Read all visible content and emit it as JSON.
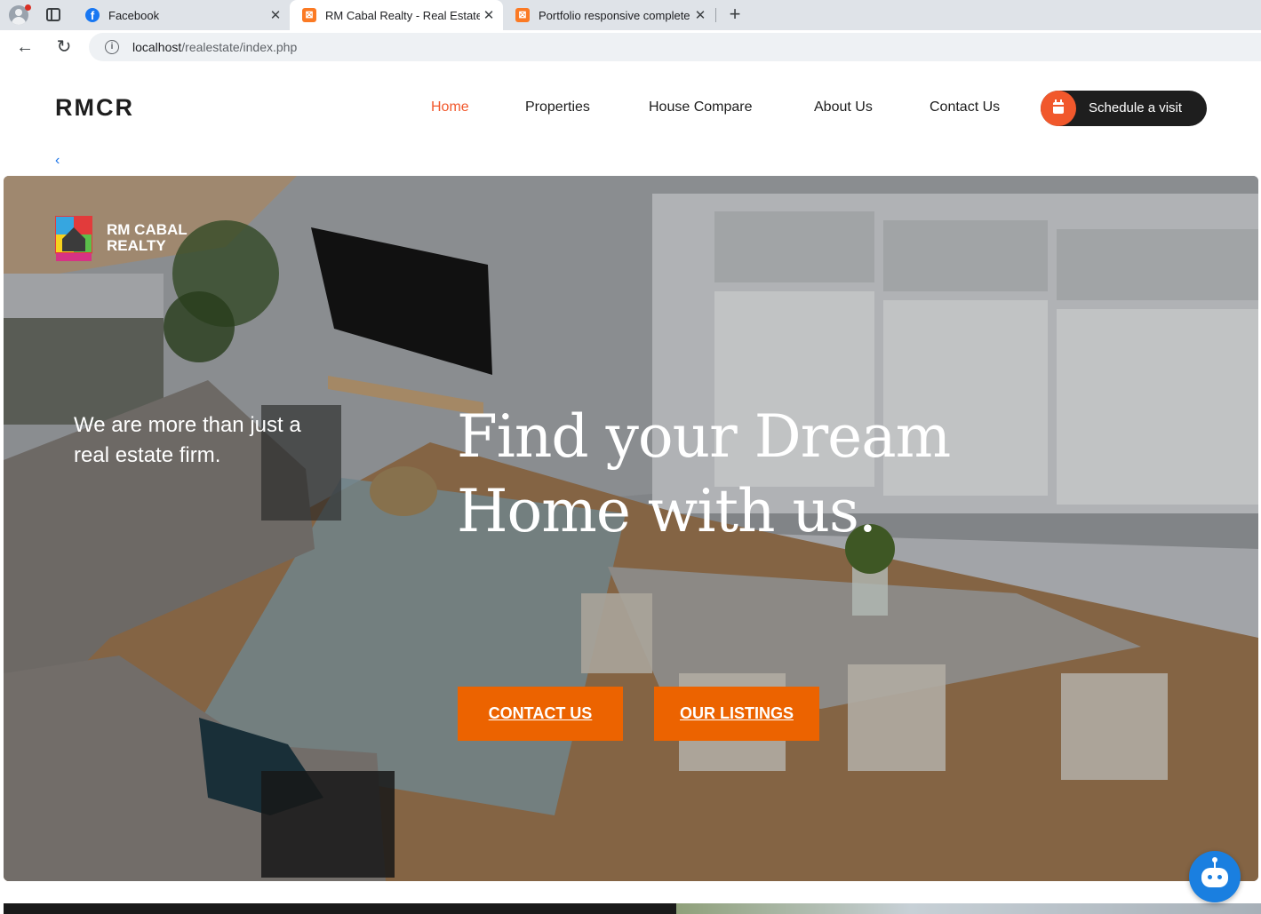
{
  "browser": {
    "tabs": [
      {
        "title": "Facebook",
        "icon": "facebook-icon"
      },
      {
        "title": "RM Cabal Realty - Real Estate",
        "icon": "xampp-icon"
      },
      {
        "title": "Portfolio responsive complete",
        "icon": "xampp-icon"
      }
    ],
    "active_tab": 1,
    "url_host": "localhost",
    "url_path": "/realestate/index.php"
  },
  "site": {
    "brand": "RMCR",
    "nav": [
      "Home",
      "Properties",
      "House Compare",
      "About Us",
      "Contact Us"
    ],
    "active_nav": "Home",
    "cta_label": "Schedule a visit",
    "back_chevron": "‹"
  },
  "hero": {
    "logo_line1": "RM CABAL",
    "logo_line2": "REALTY",
    "tagline": "We are more than just a real estate firm.",
    "headline_line1": "Find your Dream",
    "headline_line2": "Home with us.",
    "buttons": [
      "CONTACT US",
      "OUR LISTINGS"
    ]
  },
  "colors": {
    "accent": "#f1582c",
    "hero_button": "#ec6300",
    "nav_text": "#1e1e1e",
    "chat_bubble": "#1a7fe0"
  }
}
